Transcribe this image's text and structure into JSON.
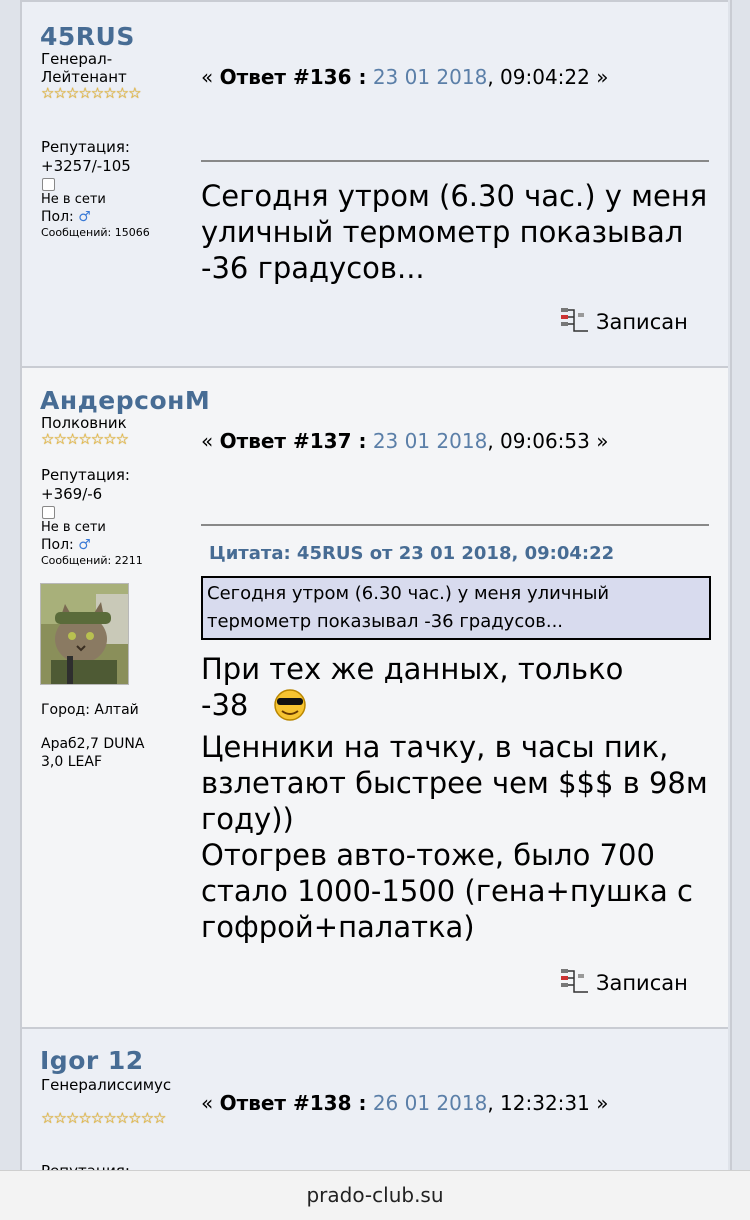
{
  "posts": [
    {
      "username": "45RUS",
      "rank": "Генерал-Лейтенант",
      "stars": "☆☆☆☆☆☆☆☆",
      "rep_label": "Репутация:",
      "rep_value": "+3257/-105",
      "status": "Не в сети",
      "gender_label": "Пол:",
      "posts_count": "Сообщений: 15066",
      "reply_prefix": "«",
      "reply_label": "Ответ #136 :",
      "date": "23 01 2018",
      "time": ", 09:04:22 »",
      "body": "Сегодня утром (6.30 час.) у меня уличный термометр показывал -36 градусов...",
      "record_label": "Записан"
    },
    {
      "username": "АндерсонМ",
      "rank": "Полковник",
      "stars": "☆☆☆☆☆☆☆",
      "rep_label": "Репутация:",
      "rep_value": "+369/-6",
      "status": "Не в сети",
      "gender_label": "Пол:",
      "posts_count": "Сообщений: 2211",
      "city": "Город: Алтай",
      "signature": "Араб2,7 DUNA 3,0 LEAF",
      "reply_prefix": "«",
      "reply_label": "Ответ #137 :",
      "date": "23 01 2018",
      "time": ", 09:06:53 »",
      "quote_header": "Цитата: 45RUS от 23 01 2018, 09:04:22",
      "quote_text": "Сегодня утром (6.30 час.) у меня уличный термометр показывал -36 градусов...",
      "body_line1": "При тех же данных, только",
      "body_line2": "-38",
      "body_rest": "Ценники на тачку, в часы пик, взлетают быстрее чем $$$ в 98м году))\nОтогрев авто-тоже, было 700 стало 1000-1500 (гена+пушка с гофрой+палатка)",
      "record_label": "Записан"
    },
    {
      "username": "Igor 12",
      "rank": "Генералиссимус",
      "stars": "☆☆☆☆☆☆☆☆☆☆",
      "rep_label": "Репутация:",
      "reply_prefix": "«",
      "reply_label": "Ответ #138 :",
      "date": "26 01 2018",
      "time": ", 12:32:31 »"
    }
  ],
  "footer": {
    "domain": "prado-club.su"
  },
  "colors": {
    "username": "#476c94",
    "date": "#5b7fa8",
    "quote_bg": "#d8dbee"
  },
  "icons": {
    "gender": "male-icon",
    "record": "record-icon",
    "smiley": "cool-smiley-icon",
    "status": "offline-checkbox-icon"
  }
}
